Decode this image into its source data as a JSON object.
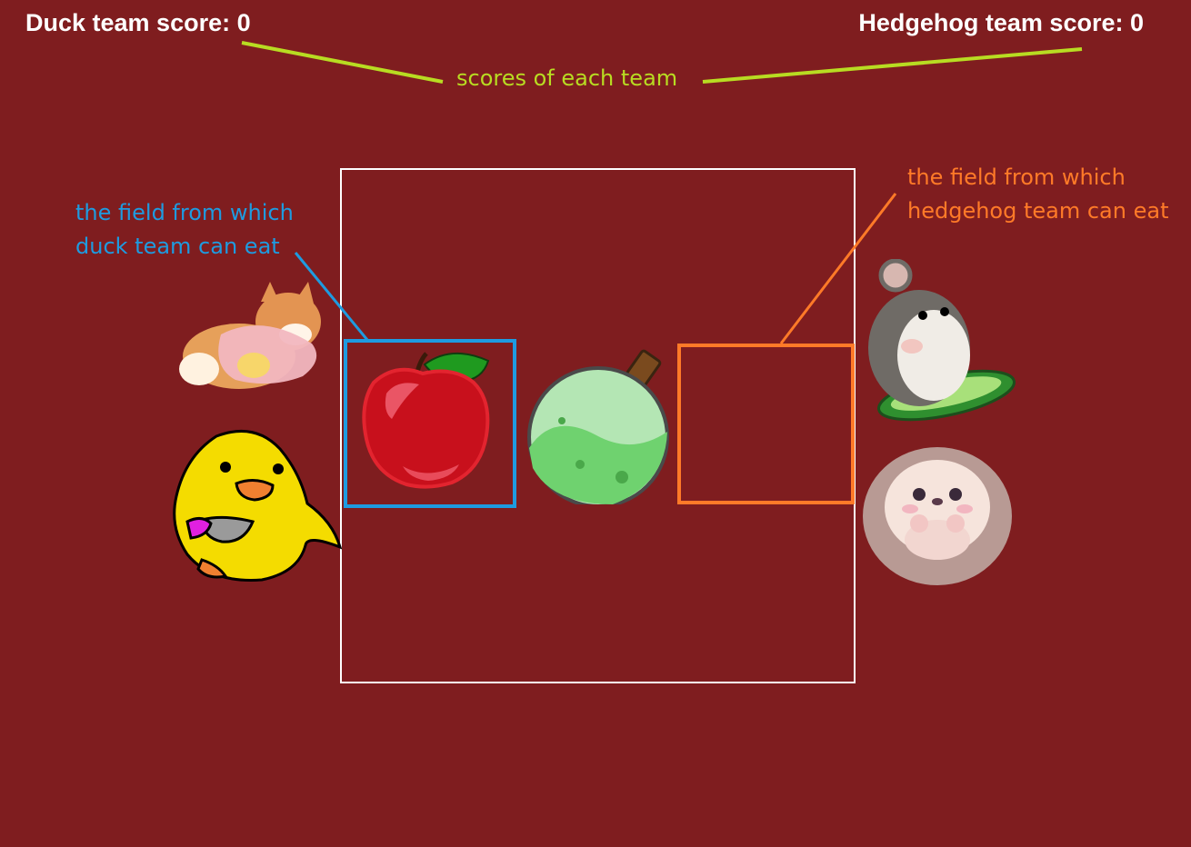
{
  "hud": {
    "duck_score_label": "Duck team score: 0",
    "hedgehog_score_label": "Hedgehog team score: 0",
    "duck_score": 0,
    "hedgehog_score": 0
  },
  "annotations": {
    "scores": "scores of each team",
    "duck_field_line1": "the field from which",
    "duck_field_line2": "duck team can eat",
    "hedgehog_field_line1": "the field from which",
    "hedgehog_field_line2": "hedgehog team can eat"
  },
  "colors": {
    "background": "#7f1d1f",
    "scores_annotation": "#b8dc22",
    "duck_annotation": "#1e9be0",
    "hedgehog_annotation": "#ff7a28",
    "board_border": "#ffffff"
  },
  "pieces": {
    "duck_team": [
      "shiba-dog-icon",
      "duck-with-knife-icon"
    ],
    "hedgehog_team": [
      "hamster-on-cucumber-icon",
      "hedgehog-icon"
    ],
    "board_items": [
      "apple-icon",
      "green-potion-icon"
    ]
  }
}
